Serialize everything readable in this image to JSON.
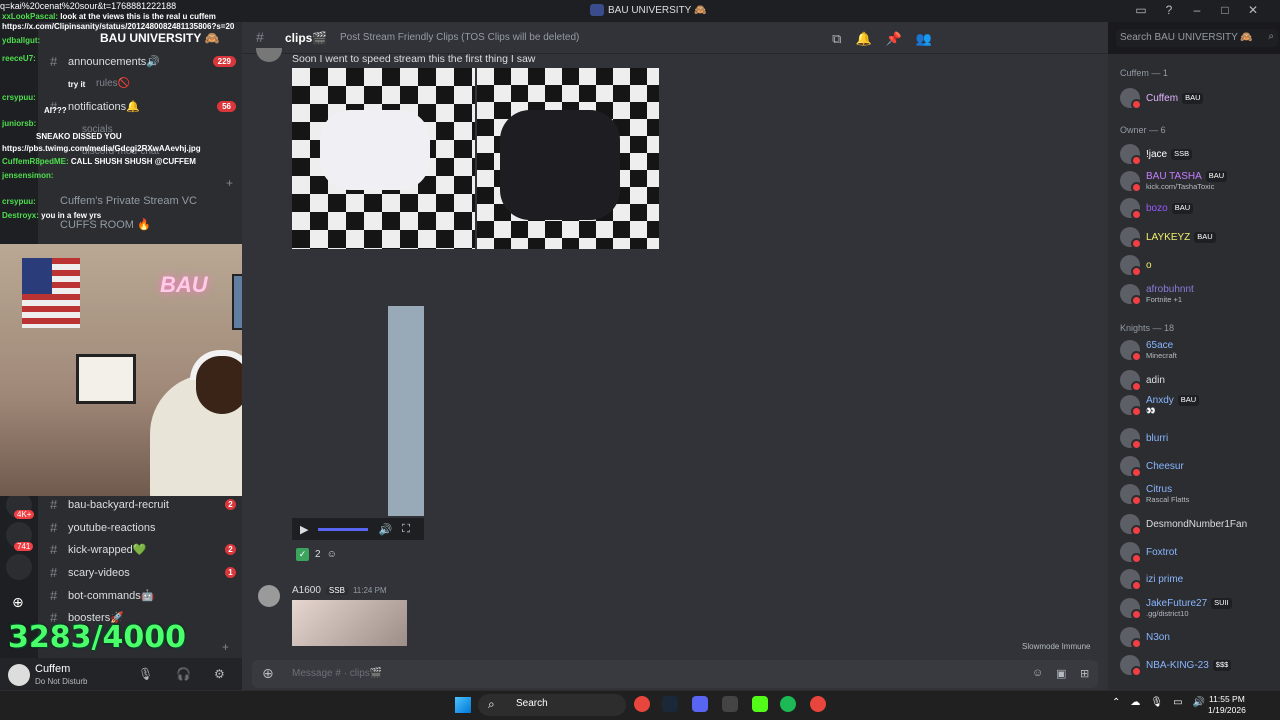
{
  "window": {
    "url_overlay": "q=kai%20cenat%20sour&t=1768881222188",
    "app_title": "BAU UNIVERSITY 🙈"
  },
  "server": {
    "name": "BAU UNIVERSITY 🙈"
  },
  "sidebar": {
    "channels_top": [
      {
        "name": "announcements🔊",
        "count": "229"
      },
      {
        "name": "notifications🔔",
        "count": "56"
      }
    ],
    "partial_rules": "rules🚫",
    "partial_socials": "socials",
    "partial_discord": "discord-mod-chat",
    "voice": [
      {
        "name": "Cuffem's Private Stream VC"
      },
      {
        "name": "CUFFS ROOM 🔥"
      }
    ],
    "channels_bottom": [
      {
        "name": "bau-backyard-recruit",
        "count": "2"
      },
      {
        "name": "youtube-reactions",
        "count": ""
      },
      {
        "name": "kick-wrapped💚",
        "count": "2"
      },
      {
        "name": "scary-videos",
        "count": "1"
      },
      {
        "name": "bot-commands🤖",
        "count": ""
      },
      {
        "name": "boosters🚀",
        "count": ""
      }
    ],
    "rail_badges": [
      "4K+",
      "741"
    ]
  },
  "stream_overlay": {
    "chat": [
      {
        "user": "ydballgut:",
        "msg": ""
      },
      {
        "user": "xxLookPascal:",
        "msg": "look at the views this is the real u cuffem"
      },
      {
        "user": "",
        "msg": "https://x.com/Clipinsanity/status/2012480082481135806?s=20"
      },
      {
        "user": "reeceU7:",
        "msg": ""
      },
      {
        "user": "",
        "msg": "try it"
      },
      {
        "user": "crsypuu:",
        "msg": ""
      },
      {
        "user": "",
        "msg": "AI???"
      },
      {
        "user": "juniorsb:",
        "msg": ""
      },
      {
        "user": "",
        "msg": "SNEAKO DISSED YOU"
      },
      {
        "user": "",
        "msg": "https://pbs.twimg.com/media/Gdcgi2RXwAAevhj.jpg"
      },
      {
        "user": "CuffemR8pedME:",
        "msg": "CALL SHUSH SHUSH @CUFFEM"
      },
      {
        "user": "jensensimon:",
        "msg": ""
      },
      {
        "user": "crsypuu:",
        "msg": ""
      },
      {
        "user": "Destroyx:",
        "msg": "you in a few yrs"
      }
    ],
    "webcam_sign": "BAU",
    "counter": "3283/4000"
  },
  "user_panel": {
    "name": "Cuffem",
    "status": "Do Not Disturb"
  },
  "channel": {
    "name": "clips🎬",
    "topic": "Post Stream Friendly Clips (TOS Clips will be deleted)",
    "search_placeholder": "Search BAU UNIVERSITY 🙈"
  },
  "messages": {
    "first_text": "Soon I went to speed stream this the first thing I saw",
    "reaction_count": "2",
    "second_author": "A1600",
    "second_tag": "SSB",
    "second_time": "11:24 PM"
  },
  "composer": {
    "placeholder": "Message #  · clips🎬",
    "slowmode": "Slowmode Immune"
  },
  "members": {
    "groups": [
      {
        "label": "Cuffem — 1"
      },
      {
        "label": "Owner — 6"
      },
      {
        "label": "Knights — 18"
      }
    ],
    "list": [
      {
        "name": "Cuffem",
        "sub": "",
        "tag": "BAU",
        "color": "#e2b4ff"
      },
      {
        "name": "!jace",
        "sub": "",
        "tag": "SSB",
        "color": "#ffffff"
      },
      {
        "name": "BAU TASHA",
        "sub": "kick.com/TashaToxic",
        "tag": "BAU",
        "color": "#c77dff"
      },
      {
        "name": "bozo",
        "sub": "",
        "tag": "BAU",
        "color": "#9a59ff"
      },
      {
        "name": "LAYKEYZ",
        "sub": "",
        "tag": "BAU",
        "color": "#f0f06a"
      },
      {
        "name": "o",
        "sub": "",
        "tag": "",
        "color": "#f0f06a"
      },
      {
        "name": "afrobuhnnt",
        "sub": "Fortnite +1",
        "tag": "",
        "color": "#8b7bd8"
      },
      {
        "name": "65ace",
        "sub": "Minecraft",
        "tag": "",
        "color": "#8ab6ff"
      },
      {
        "name": "adin",
        "sub": "",
        "tag": "",
        "color": "#dbdee1"
      },
      {
        "name": "Anxdy",
        "sub": "👀",
        "tag": "BAU",
        "color": "#8ab6ff"
      },
      {
        "name": "blurri",
        "sub": "",
        "tag": "",
        "color": "#8ab6ff"
      },
      {
        "name": "Cheesur",
        "sub": "",
        "tag": "",
        "color": "#8ab6ff"
      },
      {
        "name": "Citrus",
        "sub": "Rascal Flatts",
        "tag": "",
        "color": "#8ab6ff"
      },
      {
        "name": "DesmondNumber1Fan",
        "sub": "",
        "tag": "",
        "color": "#dbdee1"
      },
      {
        "name": "Foxtrot",
        "sub": "",
        "tag": "",
        "color": "#8ab6ff"
      },
      {
        "name": "izi prime",
        "sub": "",
        "tag": "",
        "color": "#8ab6ff"
      },
      {
        "name": "JakeFuture27",
        "sub": ".gg/district10",
        "tag": "SUII",
        "color": "#8ab6ff"
      },
      {
        "name": "N3on",
        "sub": "",
        "tag": "",
        "color": "#8ab6ff"
      },
      {
        "name": "NBA-KING-23",
        "sub": "",
        "tag": "$$$",
        "color": "#8ab6ff"
      }
    ]
  },
  "taskbar": {
    "search": "Search",
    "time": "11:55 PM",
    "date": "1/19/2026"
  }
}
